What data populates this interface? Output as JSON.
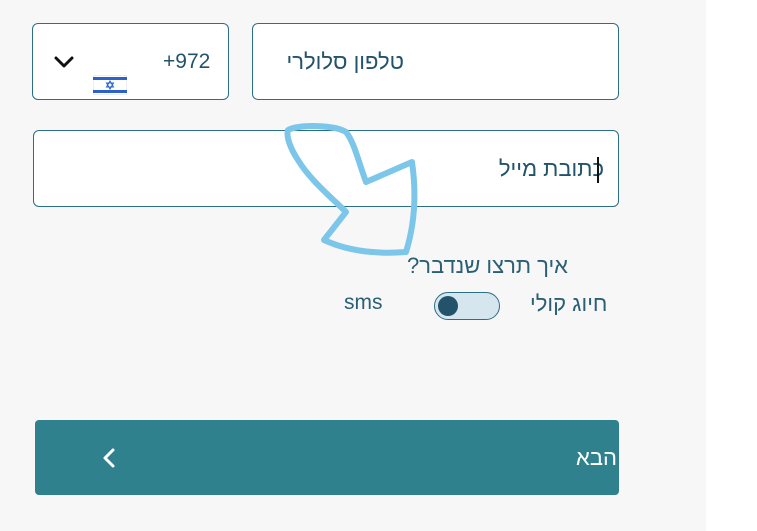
{
  "form": {
    "phone_placeholder": "טלפון סלולרי",
    "country_code": "+972",
    "country_flag": "israel-flag-icon",
    "email_value": "כתובת מייל",
    "contact_question": "איך תרצו שנדבר?",
    "voice_option": "חיוג קולי",
    "sms_option": "sms",
    "sms_toggle_on": false,
    "next_label": "הבא"
  },
  "colors": {
    "accent": "#2e818d",
    "text": "#23536a",
    "border": "#2b6f86",
    "annotation": "#7cc6ea"
  }
}
